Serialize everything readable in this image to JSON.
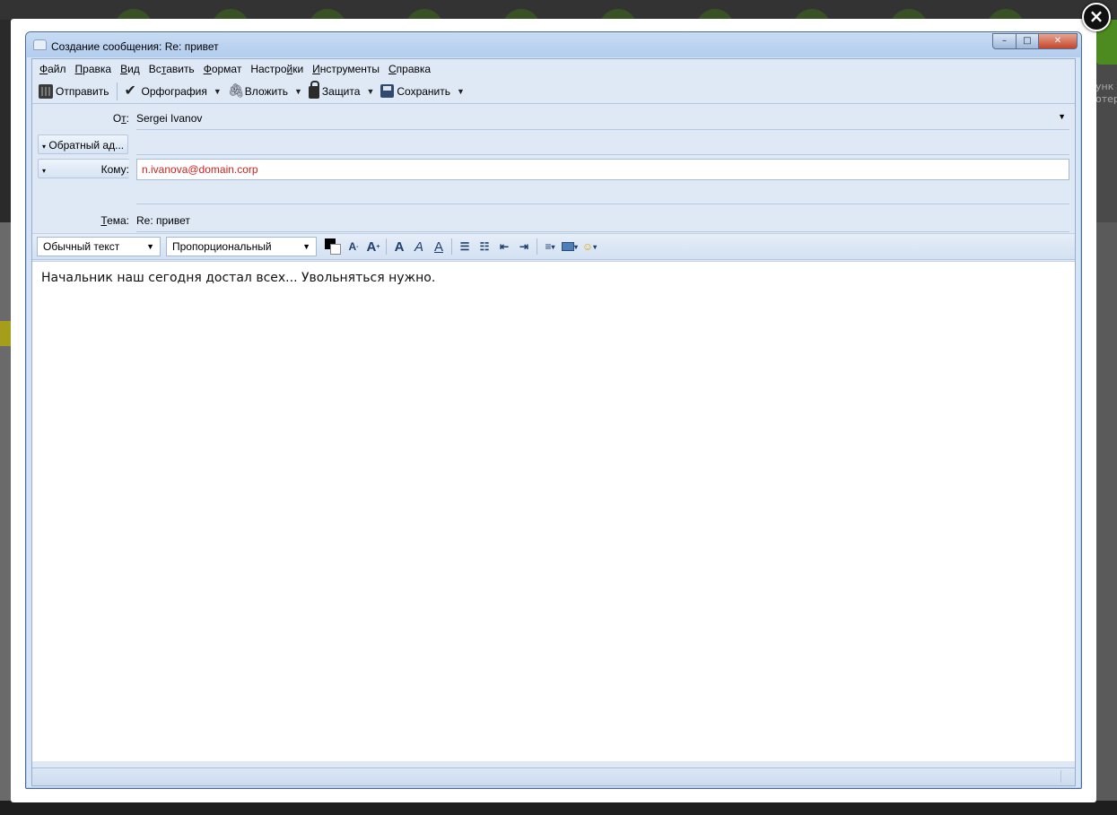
{
  "window": {
    "title": "Создание сообщения: Re: привет",
    "close_symbol": "×",
    "minimize_symbol": "–",
    "maximize_symbol": "□",
    "window_close_symbol": "✕"
  },
  "menubar": {
    "items": [
      {
        "u": "Ф",
        "rest": "айл"
      },
      {
        "u": "П",
        "rest": "равка"
      },
      {
        "u": "В",
        "rest": "ид"
      },
      {
        "pre": "Вс",
        "u": "т",
        "rest": "авить"
      },
      {
        "u": "Ф",
        "rest": "ормат"
      },
      {
        "pre": "Настро",
        "u": "й",
        "rest": "ки"
      },
      {
        "u": "И",
        "rest": "нструменты"
      },
      {
        "u": "С",
        "rest": "правка"
      }
    ]
  },
  "toolbar": {
    "send_label": "Отправить",
    "spelling_label": "Орфография",
    "attach_label": "Вложить",
    "security_label": "Защита",
    "save_label": "Сохранить",
    "dropdown_symbol": "▼"
  },
  "header": {
    "from_label_pre": "О",
    "from_label_u": "т",
    "from_label_post": ":",
    "from_value": "Sergei Ivanov",
    "reply_to_button": "Обратный ад...",
    "to_toggle": "▾",
    "to_label": "Кому:",
    "to_value": "n.ivanova@domain.corp",
    "subject_label_u": "Т",
    "subject_label_post": "ема:",
    "subject_value": "Re: привет"
  },
  "format_toolbar": {
    "paragraph_style": "Обычный текст",
    "font_family": "Пропорциональный",
    "select_arrow": "▼",
    "text_color": "#000000",
    "bg_color": "#ffffff"
  },
  "editor": {
    "body_text": "Начальник наш сегодня достал всех... Увольняться нужно."
  },
  "background": {
    "right_text_line1": "унк",
    "right_text_line2": "отер"
  }
}
